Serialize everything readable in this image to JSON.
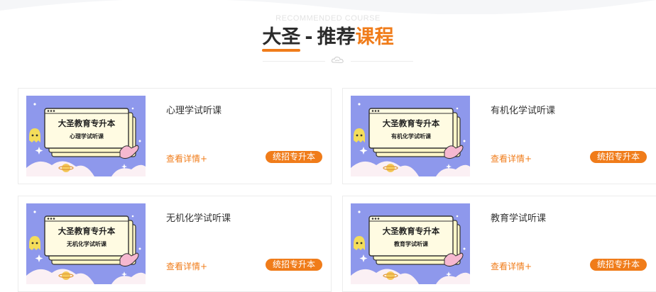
{
  "header": {
    "subtitle": "RECOMMENDED COURSE",
    "brand": "大圣",
    "separator": "-",
    "title_dark": "推荐",
    "title_accent": "课程"
  },
  "colors": {
    "accent": "#f07c1a",
    "card_border": "#ececec",
    "thumb_bg": "#8e98ec",
    "thumb_panel": "#fdf6c8",
    "thumb_ghost": "#f4dd5a",
    "thumb_hand": "#f6b8d0"
  },
  "courses": [
    {
      "title": "心理学试听课",
      "thumb_heading": "大圣教育专升本",
      "thumb_subject": "心理学试听课",
      "detail_label": "查看详情+",
      "tag_label": "统招专升本"
    },
    {
      "title": "有机化学试听课",
      "thumb_heading": "大圣教育专升本",
      "thumb_subject": "有机化学试听课",
      "detail_label": "查看详情+",
      "tag_label": "统招专升本"
    },
    {
      "title": "无机化学试听课",
      "thumb_heading": "大圣教育专升本",
      "thumb_subject": "无机化学试听课",
      "detail_label": "查看详情+",
      "tag_label": "统招专升本"
    },
    {
      "title": "教育学试听课",
      "thumb_heading": "大圣教育专升本",
      "thumb_subject": "教育学试听课",
      "detail_label": "查看详情+",
      "tag_label": "统招专升本"
    }
  ]
}
